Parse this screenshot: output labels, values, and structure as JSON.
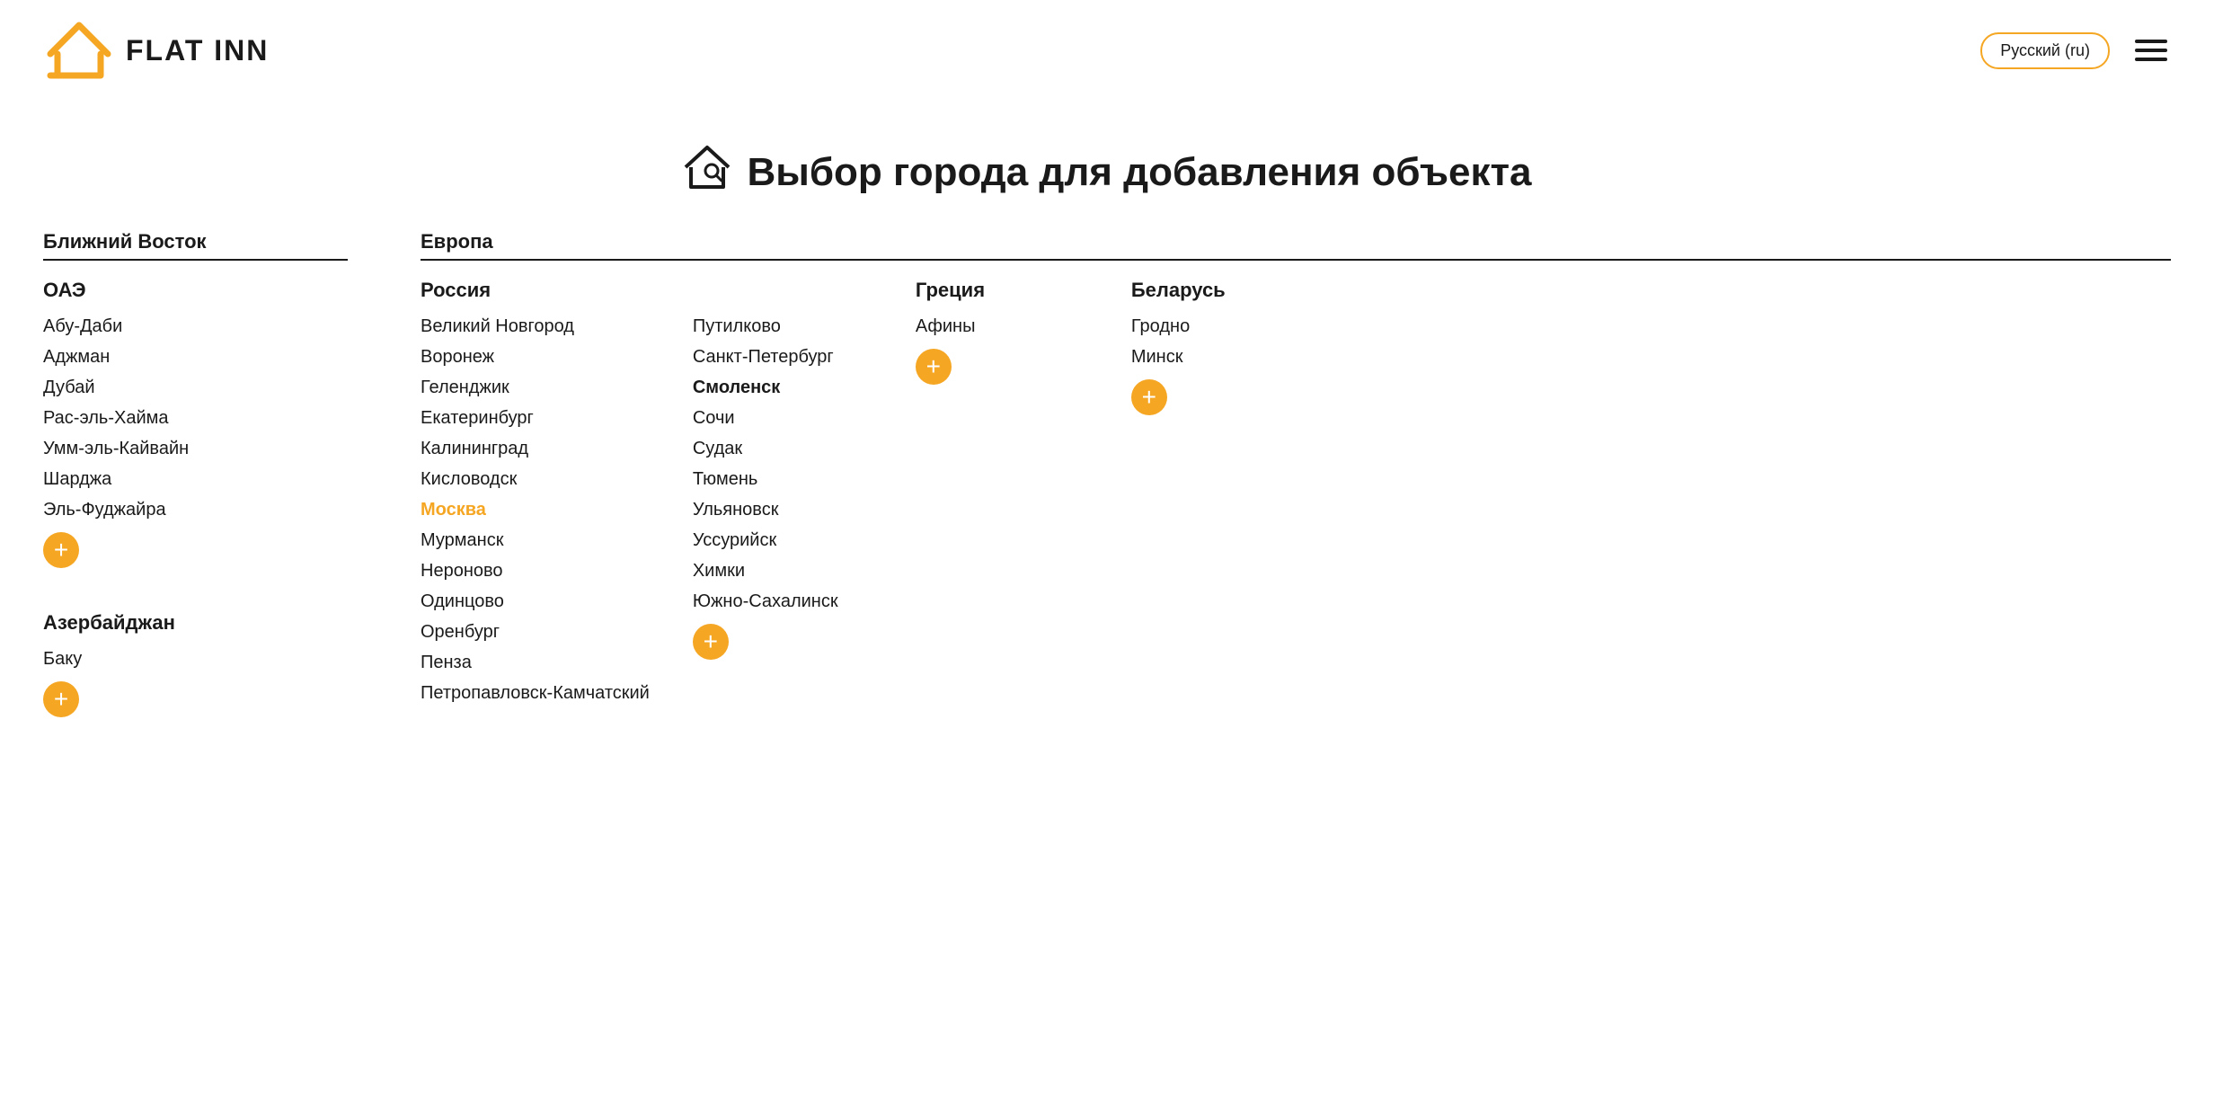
{
  "header": {
    "logo_text": "FLAT INN",
    "language": "Русский (ru)",
    "hamburger_lines": [
      "",
      "",
      ""
    ]
  },
  "page": {
    "title": "Выбор города для добавления объекта"
  },
  "regions": {
    "middle_east": {
      "label": "Ближний Восток",
      "countries": [
        {
          "name": "ОАЭ",
          "cities": [
            "Абу-Даби",
            "Аджман",
            "Дубай",
            "Рас-эль-Хайма",
            "Умм-эль-Кайвайн",
            "Шарджа",
            "Эль-Фуджайра"
          ],
          "has_add": true
        },
        {
          "name": "Азербайджан",
          "cities": [
            "Баку"
          ],
          "has_add": true
        }
      ]
    },
    "europe": {
      "label": "Европа",
      "russia": {
        "name": "Россия",
        "col1": [
          "Великий Новгород",
          "Воронеж",
          "Геленджик",
          "Екатеринбург",
          "Калининград",
          "Кисловодск",
          "Москва",
          "Мурманск",
          "Нероново",
          "Одинцово",
          "Оренбург",
          "Пенза",
          "Петропавловск-Камчатский"
        ],
        "col2": [
          "Путилково",
          "Санкт-Петербург",
          "Смоленск",
          "Сочи",
          "Судак",
          "Тюмень",
          "Ульяновск",
          "Уссурийск",
          "Химки",
          "Южно-Сахалинск"
        ],
        "active_city": "Москва",
        "bold_city": "Смоленск",
        "has_add": true
      },
      "greece": {
        "name": "Греция",
        "cities": [
          "Афины"
        ],
        "has_add": true
      },
      "belarus": {
        "name": "Беларусь",
        "cities": [
          "Гродно",
          "Минск"
        ],
        "has_add": true
      }
    }
  },
  "buttons": {
    "add_label": "+"
  }
}
